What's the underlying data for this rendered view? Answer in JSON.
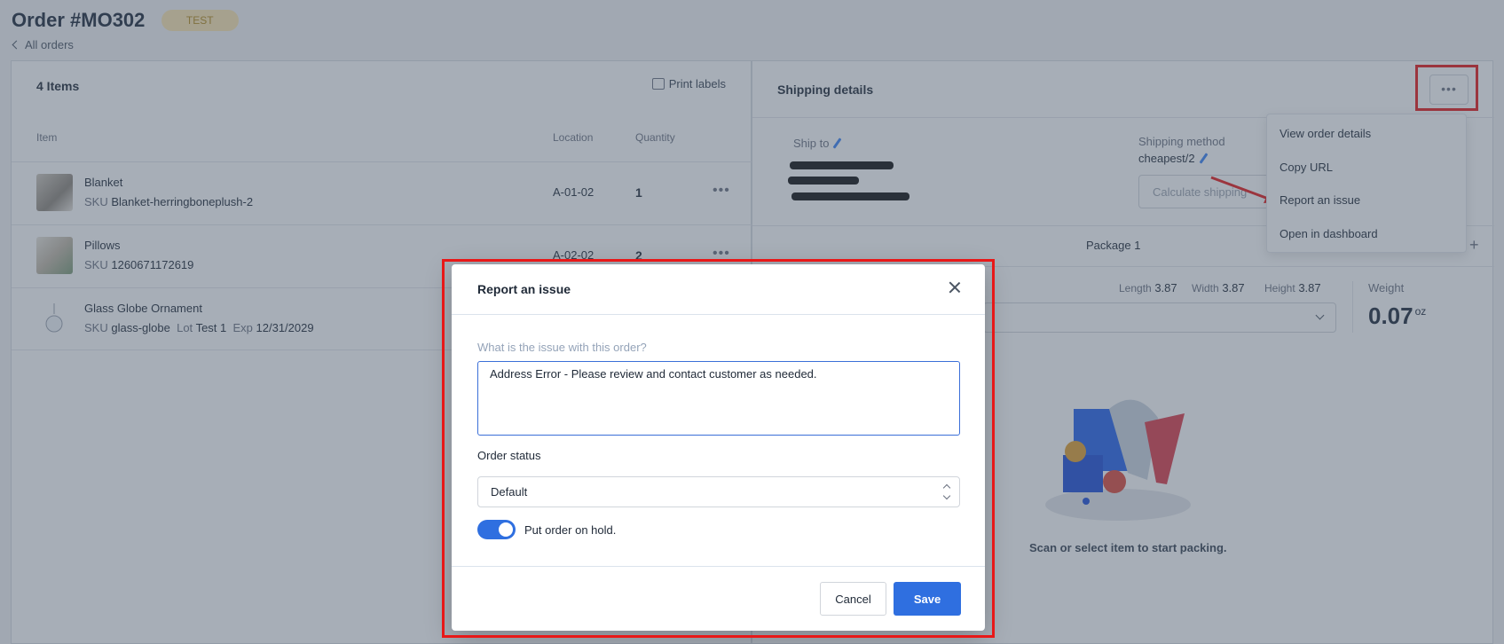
{
  "page": {
    "order_title": "Order #MO302",
    "badge": "TEST",
    "back_link": "All orders"
  },
  "items_panel": {
    "count_label": "4 Items",
    "print_labels": "Print labels",
    "columns": {
      "item": "Item",
      "location": "Location",
      "quantity": "Quantity"
    },
    "rows": [
      {
        "name": "Blanket",
        "sku_label": "SKU",
        "sku": "Blanket-herringboneplush-2",
        "location": "A-01-02",
        "quantity": "1"
      },
      {
        "name": "Pillows",
        "sku_label": "SKU",
        "sku": "1260671172619",
        "location": "A-02-02",
        "quantity": "2"
      },
      {
        "name": "Glass Globe Ornament",
        "sku_label": "SKU",
        "sku": "glass-globe",
        "lot_label": "Lot",
        "lot": "Test 1",
        "exp_label": "Exp",
        "exp": "12/31/2029"
      }
    ]
  },
  "shipping": {
    "title": "Shipping details",
    "ship_to_label": "Ship to",
    "method_label": "Shipping method",
    "method_value": "cheapest/2",
    "calculate_button": "Calculate shipping",
    "package_tab": "Package 1",
    "length_label": "Length",
    "length": "3.87",
    "width_label": "Width",
    "width": "3.87",
    "height_label": "Height",
    "height": "3.87",
    "weight_label": "Weight",
    "weight_value": "0.07",
    "weight_unit": "oz",
    "scan_prompt": "Scan or select item to start packing."
  },
  "menu": {
    "items": [
      "View order details",
      "Copy URL",
      "Report an issue",
      "Open in dashboard"
    ]
  },
  "modal": {
    "title": "Report an issue",
    "question_label": "What is the issue with this order?",
    "issue_text": "Address Error - Please review and contact customer as needed.",
    "status_label": "Order status",
    "status_value": "Default",
    "hold_label": "Put order on hold.",
    "hold_on": true,
    "cancel_label": "Cancel",
    "save_label": "Save"
  },
  "colors": {
    "accent": "#2f6fe0",
    "highlight": "#e81818",
    "badge_bg": "#fde7b0",
    "badge_text": "#b58a1c"
  }
}
